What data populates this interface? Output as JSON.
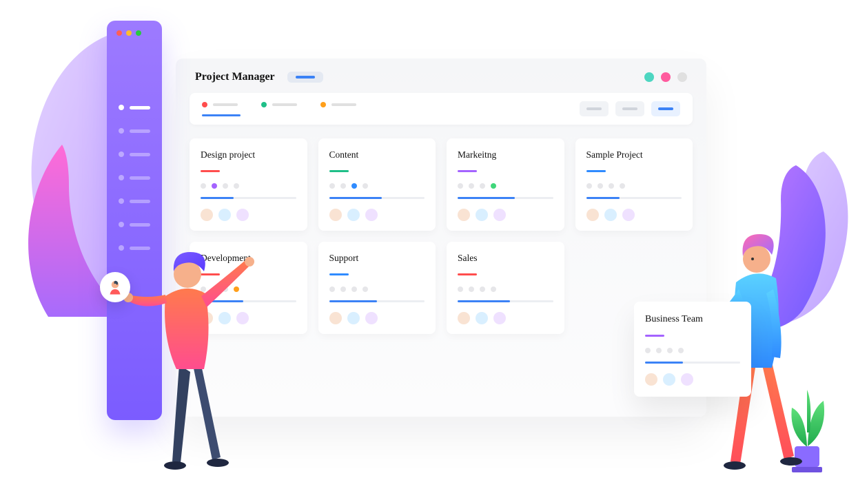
{
  "window": {
    "dots": [
      "#ff5f57",
      "#febc2e",
      "#28c840"
    ]
  },
  "sidebar": {
    "items": [
      {
        "active": true
      },
      {
        "active": false
      },
      {
        "active": false
      },
      {
        "active": false
      },
      {
        "active": false
      },
      {
        "active": false
      },
      {
        "active": false
      }
    ]
  },
  "header": {
    "title": "Project Manager",
    "avatars": [
      "#4dd6c1",
      "#ff5b9e",
      "#e0e0e0"
    ]
  },
  "toolbar": {
    "tabs": [
      {
        "dot": "#ff4d4d",
        "active": true
      },
      {
        "dot": "#1fbf88",
        "active": false
      },
      {
        "dot": "#ff9f1a",
        "active": false
      }
    ]
  },
  "cards": [
    {
      "title": "Design project",
      "accent": "#ff4d4d",
      "dotHighlight": {
        "index": 1,
        "color": "#a463ff"
      },
      "progress": 35,
      "avatars": [
        "#f9e3d3",
        "#d9efff",
        "#efe1ff"
      ]
    },
    {
      "title": "Content",
      "accent": "#1fbf88",
      "dotHighlight": {
        "index": 2,
        "color": "#2f8bff"
      },
      "progress": 55,
      "avatars": [
        "#f9e3d3",
        "#d9efff",
        "#efe1ff"
      ]
    },
    {
      "title": "Markeitng",
      "accent": "#a463ff",
      "dotHighlight": {
        "index": 3,
        "color": "#3fd67a"
      },
      "progress": 60,
      "avatars": [
        "#f9e3d3",
        "#d9efff",
        "#efe1ff"
      ]
    },
    {
      "title": "Sample Project",
      "accent": "#2f8bff",
      "dotHighlight": null,
      "progress": 35,
      "avatars": [
        "#f9e3d3",
        "#d9efff",
        "#efe1ff"
      ]
    },
    {
      "title": "Development",
      "accent": "#ff4d4d",
      "dotHighlight": {
        "index": 3,
        "color": "#ff9f1a"
      },
      "progress": 45,
      "avatars": [
        "#f9e3d3",
        "#d9efff",
        "#efe1ff"
      ]
    },
    {
      "title": "Support",
      "accent": "#2f8bff",
      "dotHighlight": null,
      "progress": 50,
      "avatars": [
        "#f9e3d3",
        "#d9efff",
        "#efe1ff"
      ]
    },
    {
      "title": "Sales",
      "accent": "#ff4d4d",
      "dotHighlight": null,
      "progress": 55,
      "avatars": [
        "#f9e3d3",
        "#d9efff",
        "#efe1ff"
      ]
    }
  ],
  "floating_card": {
    "title": "Business Team",
    "accent": "#a463ff",
    "progress": 40,
    "avatars": [
      "#f9e3d3",
      "#d9efff",
      "#efe1ff"
    ]
  }
}
